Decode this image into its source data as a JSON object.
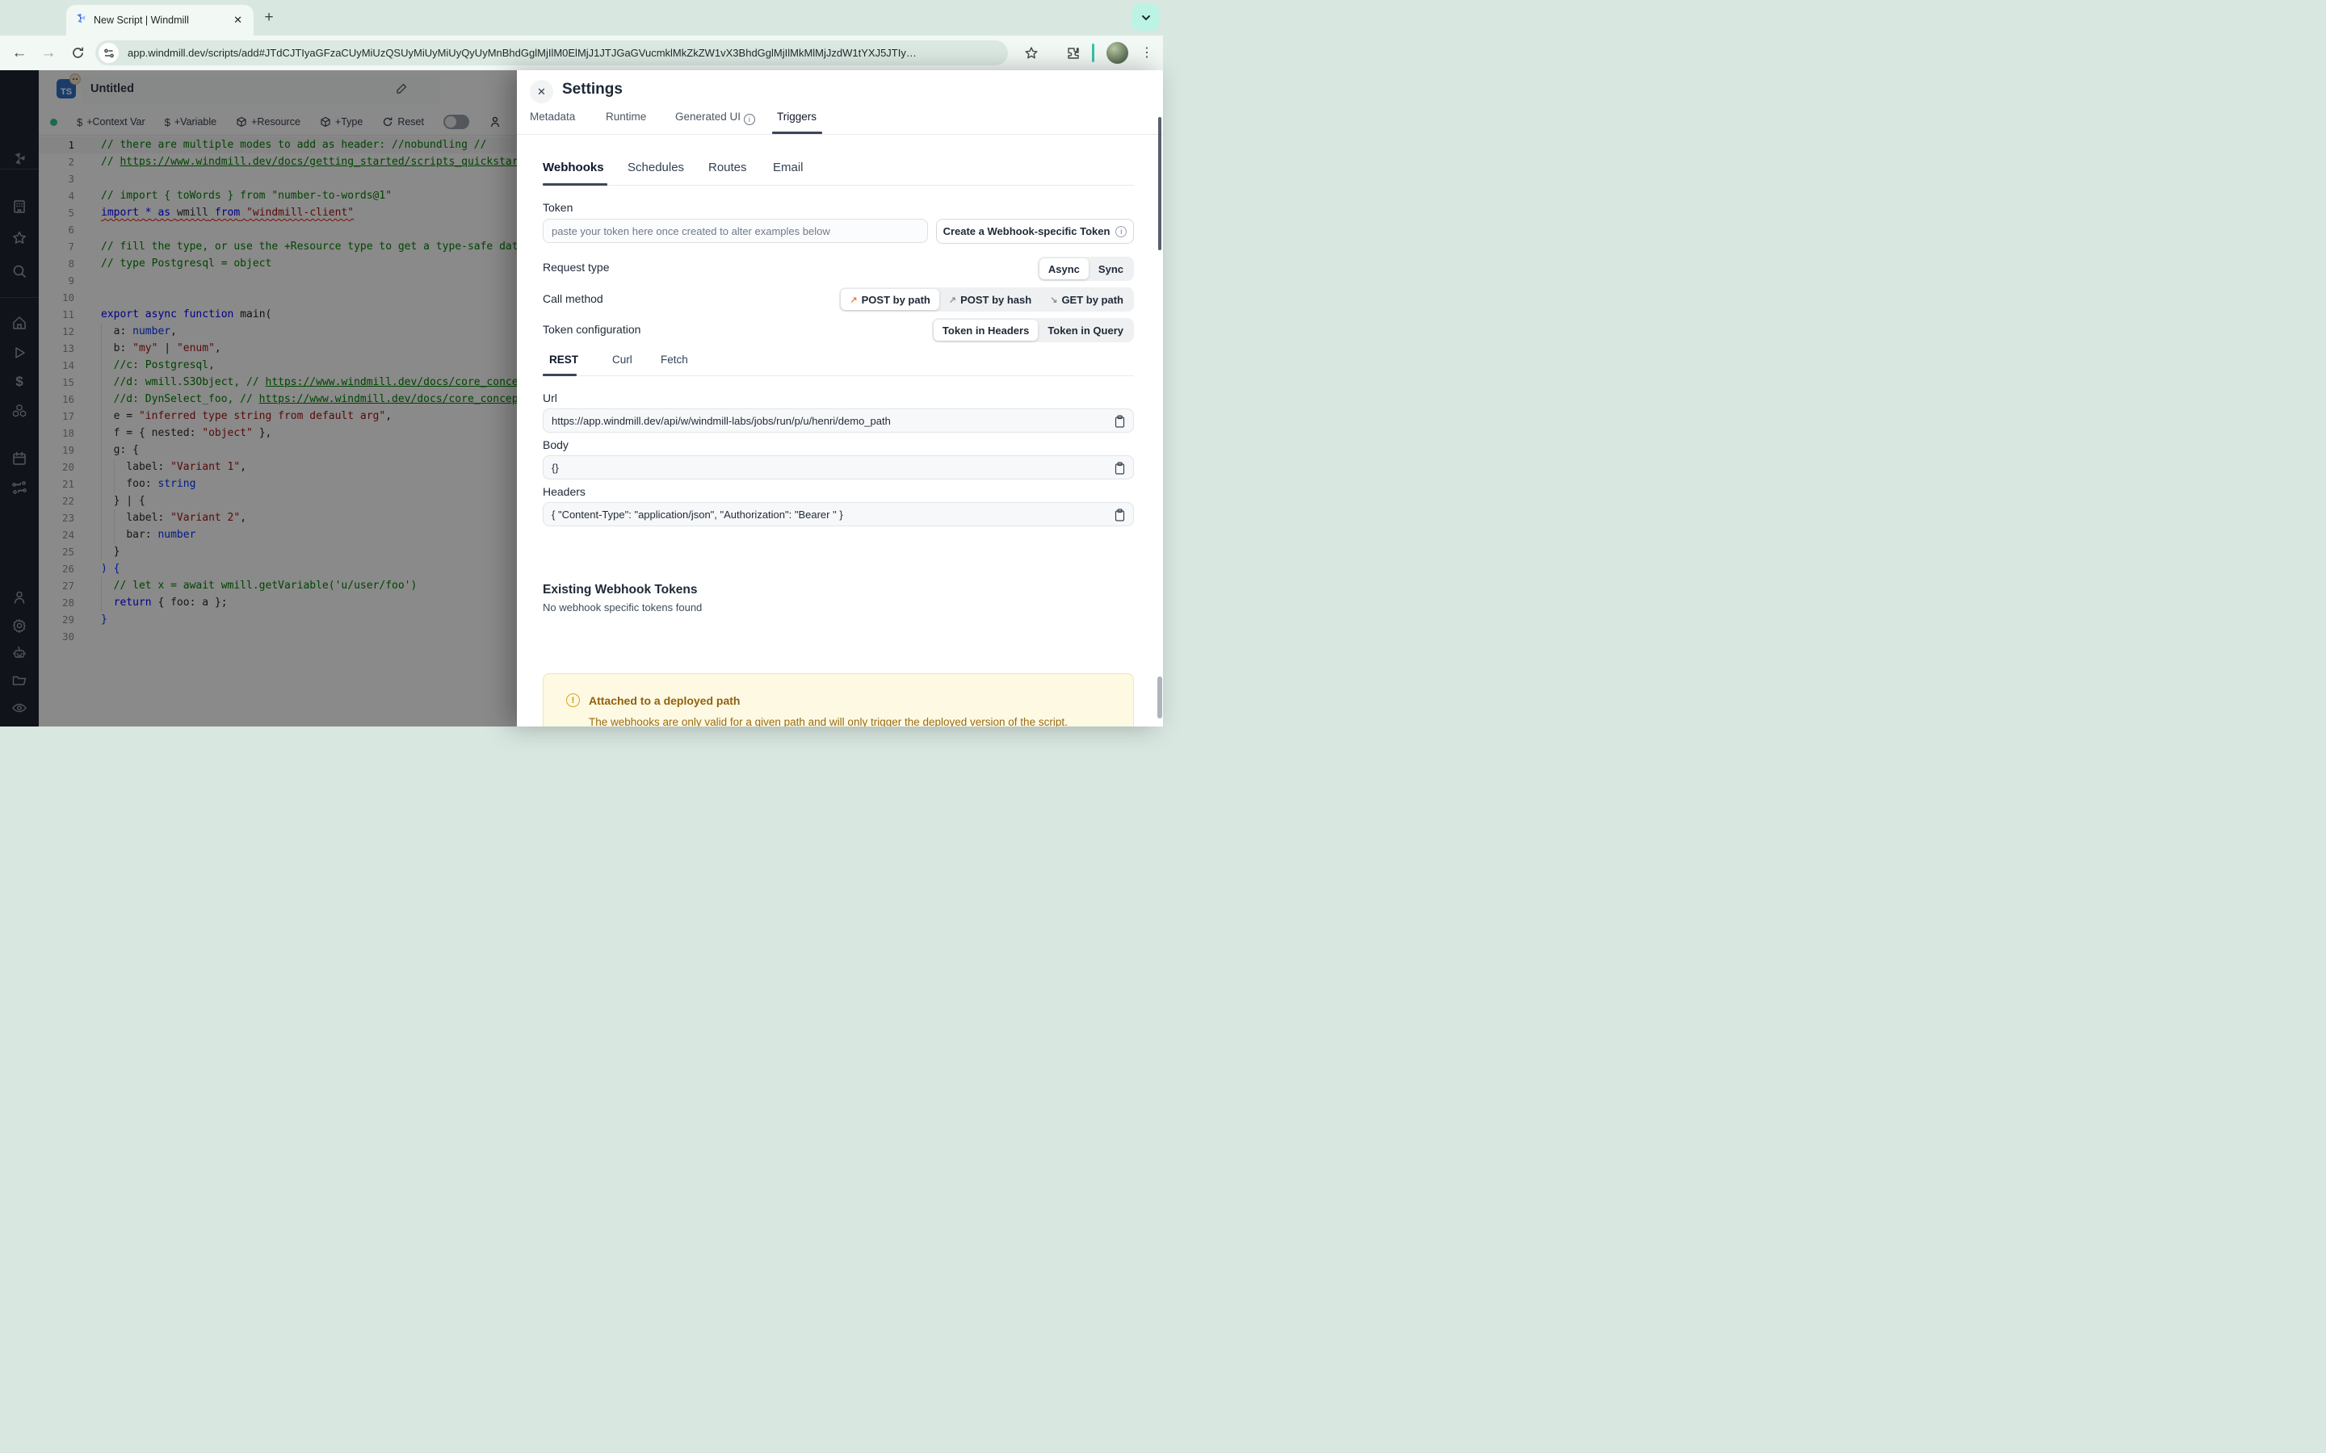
{
  "browser": {
    "tab_title": "New Script | Windmill",
    "new_tab_label": "+",
    "url": "app.windmill.dev/scripts/add#JTdCJTIyaGFzaCUyMiUzQSUyMiUyMiUyQyUyMnBhdGglMjIlM0ElMjJ1JTJGaGVucmklMkZkZW1vX3BhdGglMjIlMkMlMjJzdW1tYXJ5JTIy…",
    "kebab_glyph": "⋮",
    "close_glyph": "✕"
  },
  "colors": {
    "chrome_bg": "#d9e7e1",
    "chrome_toolbar": "#f2f8f4",
    "mint_accent": "#bdf3e5",
    "sidebar_bg": "#1f2531",
    "tab_underline": "#3b4657",
    "orange_arrow": "#e8833a",
    "warning_bg": "#fdf9e3",
    "warning_text": "#92610e",
    "status_green": "#31c48d"
  },
  "sidebar": {
    "icons": [
      "windmill-logo",
      "workspace-building",
      "favorites-star",
      "search",
      "home",
      "runs-play",
      "variables-dollar",
      "resources-cubes",
      "schedules-calendar",
      "routes-flow",
      "user",
      "settings-gear",
      "workers-robot",
      "folders",
      "audit-eye",
      "help",
      "collapse-arrow"
    ]
  },
  "editor": {
    "lang_badge": "TS",
    "title": "Untitled",
    "toolbar": {
      "context_var": "+Context Var",
      "variable": "+Variable",
      "resource": "+Resource",
      "type": "+Type",
      "reset": "Reset"
    },
    "code": {
      "lines": [
        {
          "n": 1,
          "a": true,
          "tk": [
            [
              "c",
              "// there are multiple modes to add as header: //nobundling //"
            ]
          ]
        },
        {
          "n": 2,
          "tk": [
            [
              "c",
              "// "
            ],
            [
              "u",
              "https://www.windmill.dev/docs/getting_started/scripts_quickstart"
            ]
          ]
        },
        {
          "n": 3,
          "tk": []
        },
        {
          "n": 4,
          "tk": [
            [
              "c",
              "// import { toWords } from \"number-to-words@1\""
            ]
          ]
        },
        {
          "n": 5,
          "q": true,
          "tk": [
            [
              "k",
              "import"
            ],
            [
              "p",
              " "
            ],
            [
              "k",
              "*"
            ],
            [
              "p",
              " "
            ],
            [
              "k",
              "as"
            ],
            [
              "p",
              " "
            ],
            [
              "i",
              "wmill"
            ],
            [
              "p",
              " "
            ],
            [
              "k",
              "from"
            ],
            [
              "p",
              " "
            ],
            [
              "s",
              "\"windmill-client\""
            ]
          ]
        },
        {
          "n": 6,
          "tk": []
        },
        {
          "n": 7,
          "tk": [
            [
              "c",
              "// fill the type, or use the +Resource type to get a type-safe database"
            ]
          ]
        },
        {
          "n": 8,
          "tk": [
            [
              "c",
              "// type Postgresql = object"
            ]
          ]
        },
        {
          "n": 9,
          "tk": []
        },
        {
          "n": 10,
          "tk": []
        },
        {
          "n": 11,
          "tk": [
            [
              "k",
              "export"
            ],
            [
              "p",
              " "
            ],
            [
              "k",
              "async"
            ],
            [
              "p",
              " "
            ],
            [
              "k",
              "function"
            ],
            [
              "p",
              " main("
            ]
          ]
        },
        {
          "n": 12,
          "tk": [
            [
              "p",
              "  "
            ],
            [
              "i",
              "a"
            ],
            [
              "p",
              ": "
            ],
            [
              "t",
              "number"
            ],
            [
              "p",
              ","
            ]
          ]
        },
        {
          "n": 13,
          "tk": [
            [
              "p",
              "  "
            ],
            [
              "i",
              "b"
            ],
            [
              "p",
              ": "
            ],
            [
              "s",
              "\"my\""
            ],
            [
              "p",
              " | "
            ],
            [
              "s",
              "\"enum\""
            ],
            [
              "p",
              ","
            ]
          ]
        },
        {
          "n": 14,
          "tk": [
            [
              "c",
              "  //c: Postgresql,"
            ]
          ]
        },
        {
          "n": 15,
          "tk": [
            [
              "c",
              "  //d: wmill.S3Object, // "
            ],
            [
              "u",
              "https://www.windmill.dev/docs/core_concepts/object_storage"
            ]
          ]
        },
        {
          "n": 16,
          "tk": [
            [
              "c",
              "  //d: DynSelect_foo, // "
            ],
            [
              "u",
              "https://www.windmill.dev/docs/core_concepts/dyn_select"
            ]
          ]
        },
        {
          "n": 17,
          "tk": [
            [
              "p",
              "  "
            ],
            [
              "i",
              "e"
            ],
            [
              "p",
              " = "
            ],
            [
              "s",
              "\"inferred type string from default arg\""
            ],
            [
              "p",
              ","
            ]
          ]
        },
        {
          "n": 18,
          "tk": [
            [
              "p",
              "  "
            ],
            [
              "i",
              "f"
            ],
            [
              "p",
              " = { "
            ],
            [
              "i",
              "nested"
            ],
            [
              "p",
              ": "
            ],
            [
              "s",
              "\"object\""
            ],
            [
              "p",
              " },"
            ]
          ]
        },
        {
          "n": 19,
          "tk": [
            [
              "p",
              "  "
            ],
            [
              "i",
              "g"
            ],
            [
              "p",
              ": {"
            ]
          ]
        },
        {
          "n": 20,
          "tk": [
            [
              "p",
              "    "
            ],
            [
              "i",
              "label"
            ],
            [
              "p",
              ": "
            ],
            [
              "s",
              "\"Variant 1\""
            ],
            [
              "p",
              ","
            ]
          ]
        },
        {
          "n": 21,
          "tk": [
            [
              "p",
              "    "
            ],
            [
              "i",
              "foo"
            ],
            [
              "p",
              ": "
            ],
            [
              "t",
              "string"
            ]
          ]
        },
        {
          "n": 22,
          "tk": [
            [
              "p",
              "  } | {"
            ]
          ]
        },
        {
          "n": 23,
          "tk": [
            [
              "p",
              "    "
            ],
            [
              "i",
              "label"
            ],
            [
              "p",
              ": "
            ],
            [
              "s",
              "\"Variant 2\""
            ],
            [
              "p",
              ","
            ]
          ]
        },
        {
          "n": 24,
          "tk": [
            [
              "p",
              "    "
            ],
            [
              "i",
              "bar"
            ],
            [
              "p",
              ": "
            ],
            [
              "t",
              "number"
            ]
          ]
        },
        {
          "n": 25,
          "tk": [
            [
              "p",
              "  }"
            ]
          ]
        },
        {
          "n": 26,
          "tk": [
            [
              "t",
              ") {"
            ]
          ]
        },
        {
          "n": 27,
          "tk": [
            [
              "c",
              "  // let x = await wmill.getVariable('u/user/foo')"
            ]
          ]
        },
        {
          "n": 28,
          "tk": [
            [
              "p",
              "  "
            ],
            [
              "k",
              "return"
            ],
            [
              "p",
              " { "
            ],
            [
              "i",
              "foo"
            ],
            [
              "p",
              ": "
            ],
            [
              "i",
              "a"
            ],
            [
              "p",
              " };"
            ]
          ]
        },
        {
          "n": 29,
          "tk": [
            [
              "t",
              "}"
            ]
          ]
        },
        {
          "n": 30,
          "tk": []
        }
      ]
    }
  },
  "settings": {
    "title": "Settings",
    "close_glyph": "✕",
    "tabs": [
      {
        "label": "Metadata"
      },
      {
        "label": "Runtime"
      },
      {
        "label": "Generated UI"
      },
      {
        "label": "Triggers"
      }
    ],
    "active_tab": "Triggers",
    "trigger_tabs": [
      {
        "label": "Webhooks"
      },
      {
        "label": "Schedules"
      },
      {
        "label": "Routes"
      },
      {
        "label": "Email"
      }
    ],
    "active_trigger_tab": "Webhooks",
    "token": {
      "label": "Token",
      "placeholder": "paste your token here once created to alter examples below",
      "create_button": "Create a Webhook-specific Token"
    },
    "request_type": {
      "label": "Request type",
      "options": [
        "Async",
        "Sync"
      ],
      "selected": "Async"
    },
    "call_method": {
      "label": "Call method",
      "options": [
        "POST by path",
        "POST by hash",
        "GET by path"
      ],
      "selected": "POST by path"
    },
    "token_config": {
      "label": "Token configuration",
      "options": [
        "Token in Headers",
        "Token in Query"
      ],
      "selected": "Token in Headers"
    },
    "example_tabs": [
      {
        "label": "REST"
      },
      {
        "label": "Curl"
      },
      {
        "label": "Fetch"
      }
    ],
    "active_example_tab": "REST",
    "fields": [
      {
        "label": "Url",
        "value": "https://app.windmill.dev/api/w/windmill-labs/jobs/run/p/u/henri/demo_path"
      },
      {
        "label": "Body",
        "value": "{}"
      },
      {
        "label": "Headers",
        "value": "{ \"Content-Type\": \"application/json\", \"Authorization\": \"Bearer \" }"
      }
    ],
    "existing_tokens": {
      "title": "Existing Webhook Tokens",
      "empty_text": "No webhook specific tokens found"
    },
    "warning": {
      "title": "Attached to a deployed path",
      "body": "The webhooks are only valid for a given path and will only trigger the deployed version of the script."
    }
  }
}
